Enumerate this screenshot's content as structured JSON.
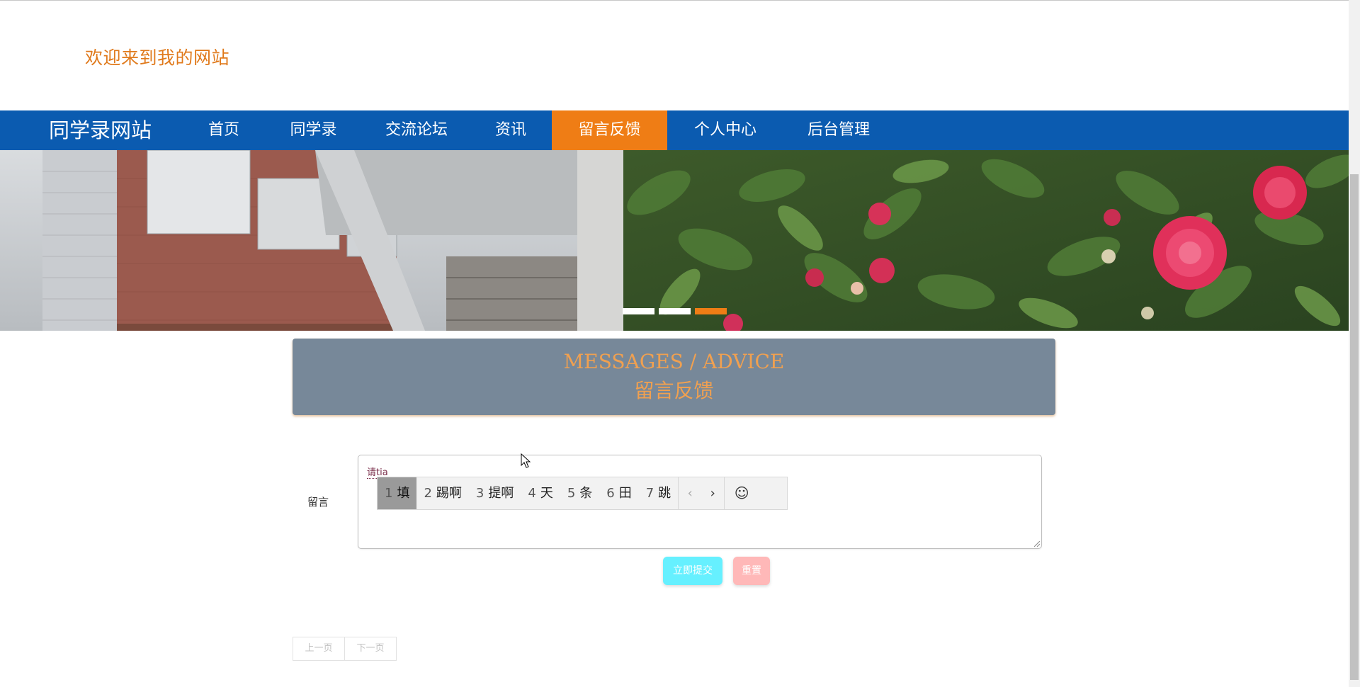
{
  "header": {
    "welcome": "欢迎来到我的网站"
  },
  "nav": {
    "brand": "同学录网站",
    "items": [
      {
        "label": "首页"
      },
      {
        "label": "同学录"
      },
      {
        "label": "交流论坛"
      },
      {
        "label": "资讯"
      },
      {
        "label": "留言反馈",
        "active": true
      },
      {
        "label": "个人中心"
      },
      {
        "label": "后台管理"
      }
    ]
  },
  "banner": {
    "slides_count": 3,
    "active_slide": 3
  },
  "section": {
    "title_en": "MESSAGES / ADVICE",
    "title_zh": "留言反馈"
  },
  "form": {
    "message_label": "留言",
    "message_value": "请tia",
    "submit_label": "立即提交",
    "reset_label": "重置"
  },
  "ime": {
    "candidates": [
      {
        "num": "1",
        "text": "填"
      },
      {
        "num": "2",
        "text": "踢啊"
      },
      {
        "num": "3",
        "text": "提啊"
      },
      {
        "num": "4",
        "text": "天"
      },
      {
        "num": "5",
        "text": "条"
      },
      {
        "num": "6",
        "text": "田"
      },
      {
        "num": "7",
        "text": "跳"
      }
    ],
    "prev_icon": "‹",
    "next_icon": "›",
    "emoji_icon": "☺"
  },
  "pagination": {
    "prev_label": "上一页",
    "next_label": "下一页"
  },
  "colors": {
    "nav_bg": "#0b5bb0",
    "nav_active": "#ef7d15",
    "accent_orange": "#e07a1c",
    "title_box": "#778899",
    "submit_btn": "#66f0ff",
    "reset_btn": "#ffb8b8"
  }
}
